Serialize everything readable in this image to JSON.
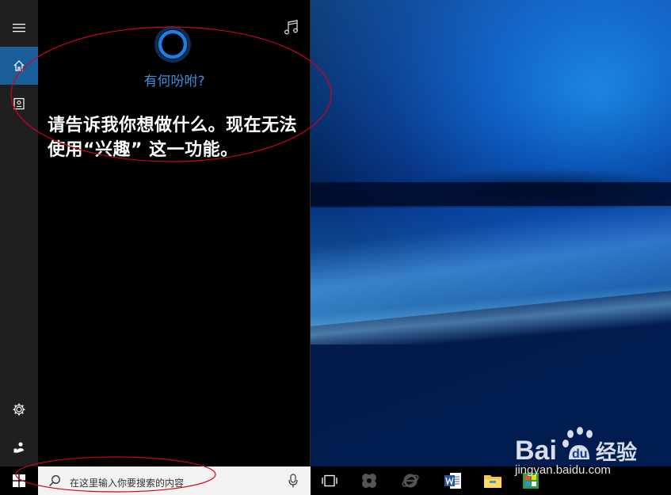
{
  "cortana": {
    "greeting": "有何吩咐?",
    "message": "请告诉我你想做什么。现在无法使用“兴趣” 这一功能。"
  },
  "taskbar": {
    "search_placeholder": "在这里输入你要搜索的内容"
  },
  "watermark": {
    "url": "jingyan.baidu.com",
    "logo_text": "Baidu经验"
  },
  "icons": {
    "menu": "hamburger-icon",
    "home": "home-icon",
    "notebook": "notebook-icon",
    "settings": "gear-icon",
    "feedback": "feedback-icon",
    "music": "music-note-icon",
    "search": "search-icon",
    "mic": "microphone-icon",
    "start": "windows-logo-icon",
    "task_view": "task-view-icon",
    "ie": "internet-explorer-icon",
    "word": "word-icon",
    "explorer": "file-explorer-icon"
  },
  "colors": {
    "accent": "#1a5e9a",
    "greeting": "#3b8ed8",
    "annotation": "#d0021b"
  }
}
